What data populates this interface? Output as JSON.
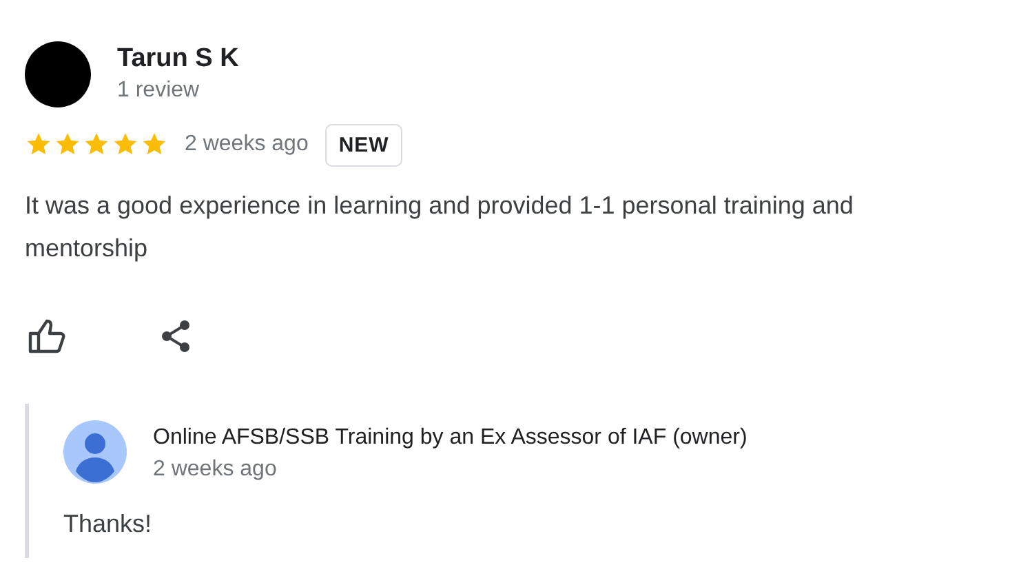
{
  "review": {
    "author": "Tarun S K",
    "author_meta": "1 review",
    "stars": 5,
    "time": "2 weeks ago",
    "badge": "NEW",
    "text": "It was a good experience in learning and provided 1-1 personal training and mentorship"
  },
  "reply": {
    "author": "Online AFSB/SSB Training by an Ex Assessor of IAF (owner)",
    "time": "2 weeks ago",
    "text": "Thanks!"
  }
}
